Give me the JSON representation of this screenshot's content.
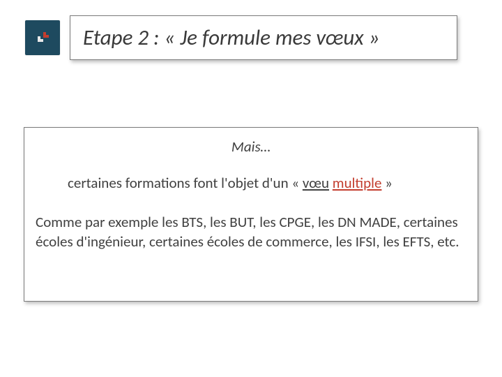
{
  "title": "Etape 2 : « Je formule mes vœux »",
  "content": {
    "lead": "Mais…",
    "sub_prefix": "certaines formations font l'objet d'un « ",
    "sub_u1": "vœu",
    "sub_gap": " ",
    "sub_u2": "multiple",
    "sub_suffix": " »",
    "body": "Comme par exemple les BTS, les BUT, les CPGE, les DN MADE, certaines écoles d'ingénieur, certaines écoles de commerce, les IFSI, les EFTS, etc."
  },
  "icon": "parcoursup-logo"
}
